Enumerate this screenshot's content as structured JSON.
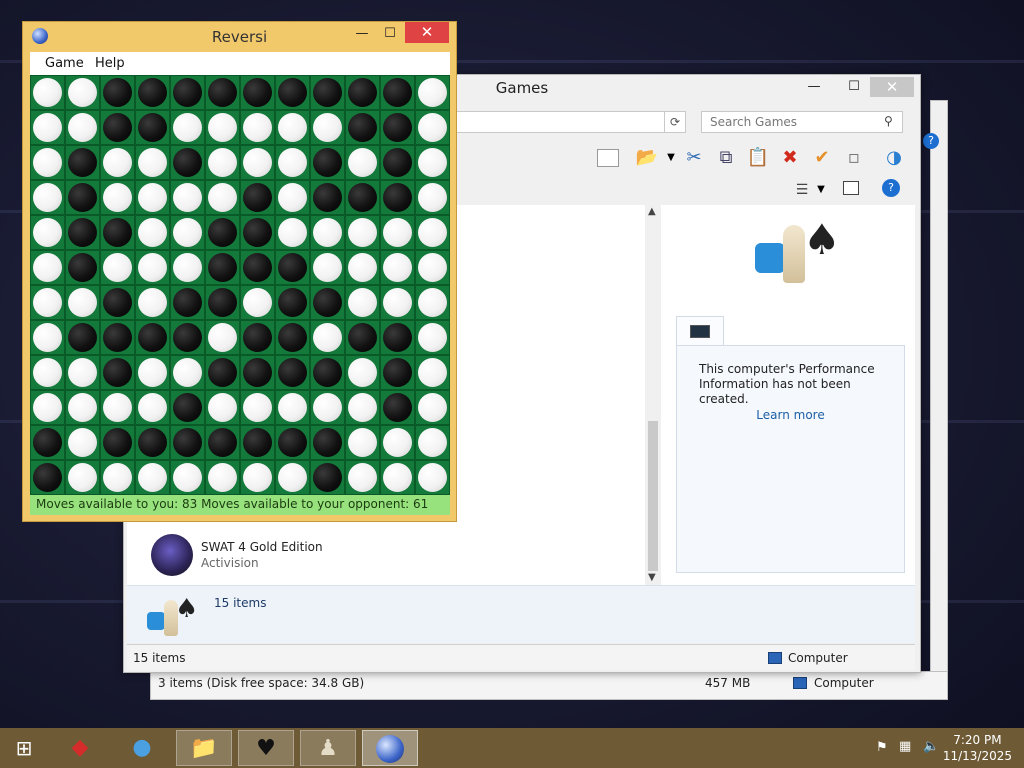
{
  "reversi": {
    "title": "Reversi",
    "menu": [
      "Game",
      "Help"
    ],
    "status": "Moves available to you:  83  Moves available to your opponent:  61",
    "board": [
      "WWBBBBBBBBBW",
      "WWBBWWWWWBBW",
      "WBWWBWWWBWBW",
      "WBWWWWBWBBBW",
      "WBBWWBBWWWWW",
      "WBWWWBBBWWWW",
      "WWBWBBWBBWWW",
      "WBBBBWBBWBBW",
      "WWBWWBBBBWBW",
      "WWWWBWWWWWBW",
      "BWBBBBBBBWWW",
      "BWWWWWWWBWWW"
    ]
  },
  "games": {
    "title": "Games",
    "search_placeholder": "Search Games",
    "item_name": "SWAT 4 Gold Edition",
    "item_publisher": "Activision",
    "perf_text": "This computer's Performance Information has not been created.",
    "learn_more": "Learn more",
    "items_count": "15 items",
    "status_items": "15 items",
    "status_location": "Computer"
  },
  "back_window": {
    "status_disk": "3 items (Disk free space: 34.8 GB)",
    "status_size": "457 MB",
    "status_location": "Computer"
  },
  "taskbar": {
    "time": "7:20 PM",
    "date": "11/13/2025"
  }
}
